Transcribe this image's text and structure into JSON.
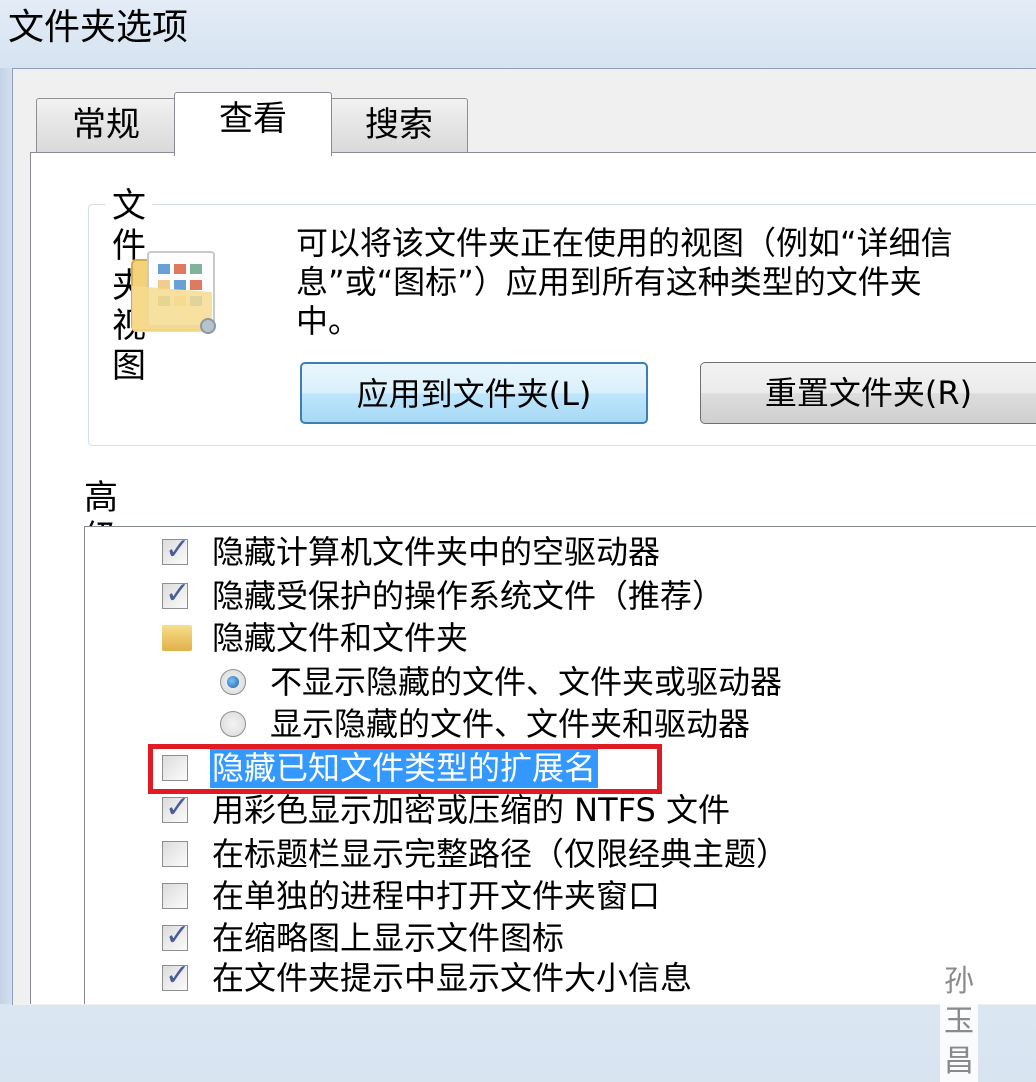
{
  "window": {
    "title": "文件夹选项"
  },
  "tabs": [
    {
      "label": "常规",
      "active": false
    },
    {
      "label": "查看",
      "active": true
    },
    {
      "label": "搜索",
      "active": false
    }
  ],
  "folder_views": {
    "legend": "文件夹视图",
    "icon": "folder-views-icon",
    "description_lines": [
      "可以将该文件夹正在使用的视图（例如“详细信",
      "息”或“图标”）应用到所有这种类型的文件夹",
      "中。"
    ],
    "apply_button": "应用到文件夹(L)",
    "reset_button": "重置文件夹(R)"
  },
  "advanced": {
    "label": "高级设置:",
    "items": [
      {
        "type": "checkbox",
        "checked": true,
        "label": "隐藏计算机文件夹中的空驱动器"
      },
      {
        "type": "checkbox",
        "checked": true,
        "label": "隐藏受保护的操作系统文件（推荐）"
      },
      {
        "type": "folder",
        "label": "隐藏文件和文件夹"
      },
      {
        "type": "radio",
        "selected": true,
        "label": "不显示隐藏的文件、文件夹或驱动器"
      },
      {
        "type": "radio",
        "selected": false,
        "label": "显示隐藏的文件、文件夹和驱动器"
      },
      {
        "type": "checkbox",
        "checked": false,
        "highlighted": true,
        "label": "隐藏已知文件类型的扩展名"
      },
      {
        "type": "checkbox",
        "checked": true,
        "label": "用彩色显示加密或压缩的 NTFS 文件"
      },
      {
        "type": "checkbox",
        "checked": false,
        "label": "在标题栏显示完整路径（仅限经典主题）"
      },
      {
        "type": "checkbox",
        "checked": false,
        "label": "在单独的进程中打开文件夹窗口"
      },
      {
        "type": "checkbox",
        "checked": true,
        "label": "在缩略图上显示文件图标"
      },
      {
        "type": "checkbox",
        "checked": true,
        "label": "在文件夹提示中显示文件大小信息"
      }
    ]
  },
  "watermark": "孙玉昌",
  "colors": {
    "selection": "#3399ff",
    "annotation_box": "#e01b24",
    "check_mark": "#4a5f97"
  }
}
